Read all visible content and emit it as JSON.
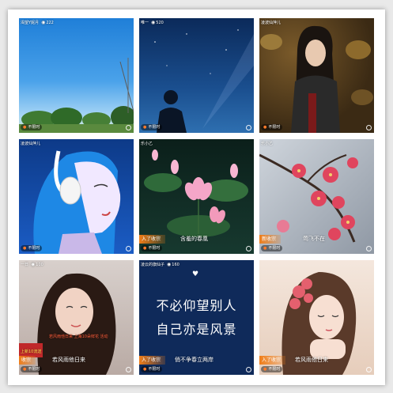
{
  "tiles": [
    {
      "name": "渴望Y妮月",
      "count": "222",
      "badge": "不限时"
    },
    {
      "name": "唯一",
      "count": "520",
      "badge": "不限时"
    },
    {
      "name": "凌波仙萍儿",
      "count": "",
      "badge": "不限时"
    },
    {
      "name": "凌波仙萍儿",
      "count": "",
      "badge": "不限时"
    },
    {
      "name": "乐小乙",
      "count": "",
      "badge": "不限时",
      "gift": "入了收宗",
      "caption": "含羞的春凰"
    },
    {
      "name": "乐小乙",
      "count": "",
      "badge": "不限时",
      "gift": "新收宗",
      "caption": "莺飞不在"
    },
    {
      "name": "一日",
      "count": "100",
      "badge": "不限时",
      "gift": "收宗",
      "caption": "若风雨他日来",
      "promo": "上新10流送",
      "overlay": "若风雨他日来 上海10朵鲜花 活动"
    },
    {
      "name": "凌云的旗仙子",
      "count": "160",
      "badge": "不限时",
      "gift": "入了收宗",
      "caption": "俏不争春立两岸",
      "quote_line1": "不必仰望别人",
      "quote_line2": "自己亦是风景"
    },
    {
      "name": "",
      "count": "",
      "badge": "不限时",
      "gift": "入了收宗",
      "caption": "若风雨他日来"
    }
  ]
}
